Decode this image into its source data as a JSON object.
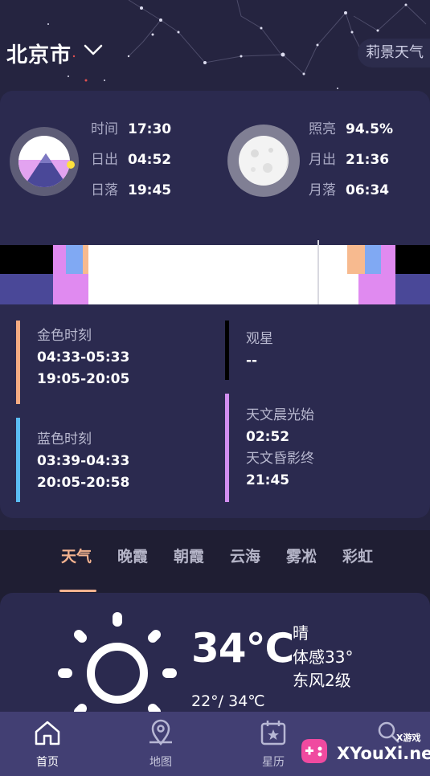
{
  "header": {
    "city": "北京市",
    "brand": "莉景天气"
  },
  "sun": {
    "rows": [
      {
        "label": "时间",
        "value": "17:30"
      },
      {
        "label": "日出",
        "value": "04:52"
      },
      {
        "label": "日落",
        "value": "19:45"
      }
    ]
  },
  "moon": {
    "rows": [
      {
        "label": "照亮",
        "value": "94.5%"
      },
      {
        "label": "月出",
        "value": "21:36"
      },
      {
        "label": "月落",
        "value": "06:34"
      }
    ]
  },
  "moments": {
    "golden": {
      "title": "金色时刻",
      "times": [
        "04:33-05:33",
        "19:05-20:05"
      ],
      "color": "#f4ab82"
    },
    "blue": {
      "title": "蓝色时刻",
      "times": [
        "03:39-04:33",
        "20:05-20:58"
      ],
      "color": "#5bbcf3"
    },
    "stargazing": {
      "title": "观星",
      "value": "--",
      "color": "#000000"
    },
    "twilight": {
      "dawn_title": "天文晨光始",
      "dawn": "02:52",
      "dusk_title": "天文昏影终",
      "dusk": "21:45",
      "color": "#d28ef0"
    }
  },
  "tabs": [
    "天气",
    "晚霞",
    "朝霞",
    "云海",
    "雾凇",
    "彩虹"
  ],
  "active_tab": "天气",
  "weather": {
    "temp": "34℃",
    "condition": "晴",
    "feels": "体感33°",
    "wind": "东风2级",
    "range": "22°/ 34℃"
  },
  "nav": [
    {
      "label": "首页",
      "icon": "home-icon",
      "active": true
    },
    {
      "label": "地图",
      "icon": "map-pin-icon",
      "active": false
    },
    {
      "label": "星历",
      "icon": "calendar-star-icon",
      "active": false
    },
    {
      "label": "",
      "icon": "search-icon",
      "active": false
    }
  ],
  "watermark": {
    "text": "XYouXi.net",
    "tag": "X游戏"
  },
  "colors": {
    "background": "#1f1e33",
    "card": "#2b2a4f",
    "accent": "#f2b28f",
    "nav": "#423f73",
    "twilight_pink": "#e08af0",
    "night_blue": "#4a4898"
  }
}
